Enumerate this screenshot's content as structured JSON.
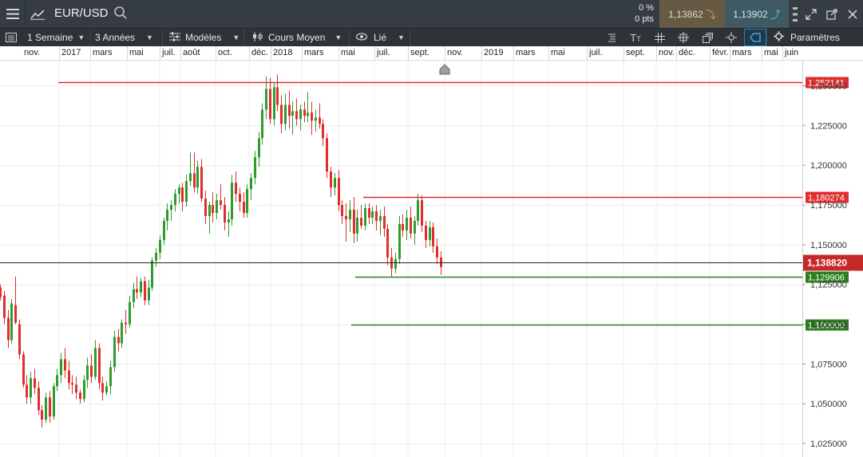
{
  "header": {
    "symbol": "EUR/USD",
    "change_percent": "0 %",
    "change_points": "0 pts",
    "sell_price": "1,13862",
    "buy_price": "1,13902",
    "icons": [
      "menu-icon",
      "chart-line-icon",
      "search-icon",
      "more-dots-icon",
      "expand-icon",
      "popout-icon",
      "close-icon"
    ]
  },
  "toolbar": {
    "interval": "1 Semaine",
    "range": "3 Années",
    "templates": "Modèles",
    "price_type": "Cours Moyen",
    "link": "Lié",
    "settings": "Paramètres",
    "icons": [
      "list-icon",
      "text-tool-icon",
      "grid-icon",
      "crosshair-icon",
      "layers-icon",
      "target-icon",
      "label-icon",
      "gear-icon"
    ]
  },
  "colors": {
    "up": "#2e9b2e",
    "down": "#e02d2d",
    "resistance": "#e02d2d",
    "support": "#2e7d1e",
    "current": "#222222",
    "current_tag": "#c62828"
  },
  "chart_data": {
    "type": "candlestick",
    "x_axis_labels": [
      "nov.",
      "2017",
      "mars",
      "mai",
      "juil.",
      "août",
      "oct.",
      "déc.",
      "2018",
      "mars",
      "mai",
      "juil.",
      "sept.",
      "nov.",
      "2019",
      "mars",
      "mai",
      "juil.",
      "sept.",
      "nov.",
      "déc.",
      "févr.",
      "mars",
      "mai",
      "juin"
    ],
    "y_ticks": [
      "1,250000",
      "1,225000",
      "1,200000",
      "1,175000",
      "1,150000",
      "1,125000",
      "1,100000",
      "1,075000",
      "1,050000",
      "1,025000"
    ],
    "ylim": [
      1.0165,
      1.2658
    ],
    "horizontal_lines": [
      {
        "label": "1,252141",
        "value": 1.252141,
        "kind": "resistance"
      },
      {
        "label": "1,180274",
        "value": 1.180274,
        "kind": "resistance"
      },
      {
        "label": "1,129906",
        "value": 1.129906,
        "kind": "support"
      },
      {
        "label": "1,100000",
        "value": 1.1,
        "kind": "support"
      }
    ],
    "current_price": {
      "label": "1,138820",
      "value": 1.13882
    },
    "candles": [
      {
        "o": 1.123,
        "h": 1.125,
        "l": 1.115,
        "c": 1.117
      },
      {
        "o": 1.118,
        "h": 1.121,
        "l": 1.1,
        "c": 1.104
      },
      {
        "o": 1.104,
        "h": 1.109,
        "l": 1.085,
        "c": 1.09
      },
      {
        "o": 1.09,
        "h": 1.116,
        "l": 1.088,
        "c": 1.113
      },
      {
        "o": 1.112,
        "h": 1.13,
        "l": 1.1,
        "c": 1.101
      },
      {
        "o": 1.1,
        "h": 1.103,
        "l": 1.078,
        "c": 1.081
      },
      {
        "o": 1.081,
        "h": 1.083,
        "l": 1.06,
        "c": 1.062
      },
      {
        "o": 1.062,
        "h": 1.068,
        "l": 1.05,
        "c": 1.054
      },
      {
        "o": 1.054,
        "h": 1.07,
        "l": 1.05,
        "c": 1.066
      },
      {
        "o": 1.066,
        "h": 1.072,
        "l": 1.056,
        "c": 1.06
      },
      {
        "o": 1.06,
        "h": 1.064,
        "l": 1.043,
        "c": 1.046
      },
      {
        "o": 1.046,
        "h": 1.049,
        "l": 1.035,
        "c": 1.04
      },
      {
        "o": 1.04,
        "h": 1.057,
        "l": 1.038,
        "c": 1.054
      },
      {
        "o": 1.054,
        "h": 1.058,
        "l": 1.038,
        "c": 1.042
      },
      {
        "o": 1.042,
        "h": 1.063,
        "l": 1.04,
        "c": 1.061
      },
      {
        "o": 1.061,
        "h": 1.072,
        "l": 1.058,
        "c": 1.068
      },
      {
        "o": 1.068,
        "h": 1.082,
        "l": 1.063,
        "c": 1.078
      },
      {
        "o": 1.078,
        "h": 1.085,
        "l": 1.066,
        "c": 1.071
      },
      {
        "o": 1.071,
        "h": 1.077,
        "l": 1.059,
        "c": 1.063
      },
      {
        "o": 1.063,
        "h": 1.068,
        "l": 1.056,
        "c": 1.062
      },
      {
        "o": 1.062,
        "h": 1.067,
        "l": 1.053,
        "c": 1.057
      },
      {
        "o": 1.057,
        "h": 1.059,
        "l": 1.05,
        "c": 1.053
      },
      {
        "o": 1.053,
        "h": 1.068,
        "l": 1.051,
        "c": 1.065
      },
      {
        "o": 1.065,
        "h": 1.079,
        "l": 1.06,
        "c": 1.074
      },
      {
        "o": 1.074,
        "h": 1.081,
        "l": 1.063,
        "c": 1.067
      },
      {
        "o": 1.067,
        "h": 1.09,
        "l": 1.065,
        "c": 1.085
      },
      {
        "o": 1.085,
        "h": 1.088,
        "l": 1.059,
        "c": 1.063
      },
      {
        "o": 1.063,
        "h": 1.067,
        "l": 1.052,
        "c": 1.057
      },
      {
        "o": 1.057,
        "h": 1.064,
        "l": 1.055,
        "c": 1.061
      },
      {
        "o": 1.061,
        "h": 1.077,
        "l": 1.056,
        "c": 1.073
      },
      {
        "o": 1.073,
        "h": 1.096,
        "l": 1.07,
        "c": 1.092
      },
      {
        "o": 1.092,
        "h": 1.097,
        "l": 1.083,
        "c": 1.088
      },
      {
        "o": 1.088,
        "h": 1.103,
        "l": 1.085,
        "c": 1.101
      },
      {
        "o": 1.101,
        "h": 1.109,
        "l": 1.094,
        "c": 1.1
      },
      {
        "o": 1.1,
        "h": 1.118,
        "l": 1.098,
        "c": 1.114
      },
      {
        "o": 1.114,
        "h": 1.126,
        "l": 1.11,
        "c": 1.122
      },
      {
        "o": 1.122,
        "h": 1.13,
        "l": 1.116,
        "c": 1.12
      },
      {
        "o": 1.12,
        "h": 1.129,
        "l": 1.117,
        "c": 1.127
      },
      {
        "o": 1.127,
        "h": 1.13,
        "l": 1.112,
        "c": 1.115
      },
      {
        "o": 1.115,
        "h": 1.128,
        "l": 1.112,
        "c": 1.123
      },
      {
        "o": 1.123,
        "h": 1.142,
        "l": 1.121,
        "c": 1.14
      },
      {
        "o": 1.14,
        "h": 1.148,
        "l": 1.136,
        "c": 1.145
      },
      {
        "o": 1.145,
        "h": 1.156,
        "l": 1.141,
        "c": 1.153
      },
      {
        "o": 1.153,
        "h": 1.167,
        "l": 1.15,
        "c": 1.165
      },
      {
        "o": 1.165,
        "h": 1.176,
        "l": 1.159,
        "c": 1.172
      },
      {
        "o": 1.172,
        "h": 1.178,
        "l": 1.165,
        "c": 1.175
      },
      {
        "o": 1.175,
        "h": 1.185,
        "l": 1.171,
        "c": 1.182
      },
      {
        "o": 1.182,
        "h": 1.188,
        "l": 1.176,
        "c": 1.186
      },
      {
        "o": 1.186,
        "h": 1.189,
        "l": 1.171,
        "c": 1.177
      },
      {
        "o": 1.177,
        "h": 1.194,
        "l": 1.174,
        "c": 1.19
      },
      {
        "o": 1.19,
        "h": 1.208,
        "l": 1.187,
        "c": 1.195
      },
      {
        "o": 1.195,
        "h": 1.208,
        "l": 1.183,
        "c": 1.186
      },
      {
        "o": 1.186,
        "h": 1.203,
        "l": 1.182,
        "c": 1.199
      },
      {
        "o": 1.199,
        "h": 1.204,
        "l": 1.177,
        "c": 1.179
      },
      {
        "o": 1.179,
        "h": 1.184,
        "l": 1.163,
        "c": 1.168
      },
      {
        "o": 1.168,
        "h": 1.177,
        "l": 1.157,
        "c": 1.175
      },
      {
        "o": 1.175,
        "h": 1.183,
        "l": 1.164,
        "c": 1.17
      },
      {
        "o": 1.17,
        "h": 1.182,
        "l": 1.166,
        "c": 1.178
      },
      {
        "o": 1.178,
        "h": 1.188,
        "l": 1.172,
        "c": 1.175
      },
      {
        "o": 1.175,
        "h": 1.18,
        "l": 1.159,
        "c": 1.164
      },
      {
        "o": 1.164,
        "h": 1.171,
        "l": 1.155,
        "c": 1.166
      },
      {
        "o": 1.166,
        "h": 1.194,
        "l": 1.162,
        "c": 1.189
      },
      {
        "o": 1.189,
        "h": 1.196,
        "l": 1.177,
        "c": 1.182
      },
      {
        "o": 1.182,
        "h": 1.186,
        "l": 1.171,
        "c": 1.177
      },
      {
        "o": 1.177,
        "h": 1.183,
        "l": 1.167,
        "c": 1.17
      },
      {
        "o": 1.17,
        "h": 1.188,
        "l": 1.167,
        "c": 1.185
      },
      {
        "o": 1.185,
        "h": 1.195,
        "l": 1.178,
        "c": 1.192
      },
      {
        "o": 1.192,
        "h": 1.209,
        "l": 1.188,
        "c": 1.205
      },
      {
        "o": 1.205,
        "h": 1.221,
        "l": 1.199,
        "c": 1.217
      },
      {
        "o": 1.217,
        "h": 1.239,
        "l": 1.213,
        "c": 1.235
      },
      {
        "o": 1.235,
        "h": 1.256,
        "l": 1.229,
        "c": 1.248
      },
      {
        "o": 1.248,
        "h": 1.255,
        "l": 1.226,
        "c": 1.229
      },
      {
        "o": 1.229,
        "h": 1.252,
        "l": 1.225,
        "c": 1.249
      },
      {
        "o": 1.249,
        "h": 1.257,
        "l": 1.234,
        "c": 1.238
      },
      {
        "o": 1.238,
        "h": 1.244,
        "l": 1.22,
        "c": 1.226
      },
      {
        "o": 1.226,
        "h": 1.245,
        "l": 1.222,
        "c": 1.238
      },
      {
        "o": 1.238,
        "h": 1.247,
        "l": 1.223,
        "c": 1.231
      },
      {
        "o": 1.231,
        "h": 1.24,
        "l": 1.219,
        "c": 1.234
      },
      {
        "o": 1.234,
        "h": 1.242,
        "l": 1.225,
        "c": 1.229
      },
      {
        "o": 1.229,
        "h": 1.238,
        "l": 1.222,
        "c": 1.235
      },
      {
        "o": 1.235,
        "h": 1.24,
        "l": 1.227,
        "c": 1.231
      },
      {
        "o": 1.231,
        "h": 1.246,
        "l": 1.227,
        "c": 1.233
      },
      {
        "o": 1.233,
        "h": 1.24,
        "l": 1.219,
        "c": 1.228
      },
      {
        "o": 1.228,
        "h": 1.235,
        "l": 1.221,
        "c": 1.23
      },
      {
        "o": 1.23,
        "h": 1.239,
        "l": 1.223,
        "c": 1.226
      },
      {
        "o": 1.226,
        "h": 1.229,
        "l": 1.212,
        "c": 1.217
      },
      {
        "o": 1.217,
        "h": 1.22,
        "l": 1.192,
        "c": 1.196
      },
      {
        "o": 1.196,
        "h": 1.199,
        "l": 1.18,
        "c": 1.186
      },
      {
        "o": 1.186,
        "h": 1.195,
        "l": 1.181,
        "c": 1.192
      },
      {
        "o": 1.192,
        "h": 1.197,
        "l": 1.171,
        "c": 1.175
      },
      {
        "o": 1.175,
        "h": 1.178,
        "l": 1.163,
        "c": 1.168
      },
      {
        "o": 1.168,
        "h": 1.176,
        "l": 1.152,
        "c": 1.166
      },
      {
        "o": 1.166,
        "h": 1.178,
        "l": 1.158,
        "c": 1.172
      },
      {
        "o": 1.172,
        "h": 1.18,
        "l": 1.151,
        "c": 1.157
      },
      {
        "o": 1.157,
        "h": 1.172,
        "l": 1.152,
        "c": 1.167
      },
      {
        "o": 1.167,
        "h": 1.175,
        "l": 1.16,
        "c": 1.162
      },
      {
        "o": 1.162,
        "h": 1.176,
        "l": 1.159,
        "c": 1.173
      },
      {
        "o": 1.173,
        "h": 1.176,
        "l": 1.163,
        "c": 1.167
      },
      {
        "o": 1.167,
        "h": 1.174,
        "l": 1.163,
        "c": 1.171
      },
      {
        "o": 1.171,
        "h": 1.175,
        "l": 1.159,
        "c": 1.165
      },
      {
        "o": 1.165,
        "h": 1.172,
        "l": 1.156,
        "c": 1.168
      },
      {
        "o": 1.168,
        "h": 1.174,
        "l": 1.155,
        "c": 1.16
      },
      {
        "o": 1.16,
        "h": 1.163,
        "l": 1.137,
        "c": 1.142
      },
      {
        "o": 1.142,
        "h": 1.148,
        "l": 1.13,
        "c": 1.135
      },
      {
        "o": 1.135,
        "h": 1.145,
        "l": 1.132,
        "c": 1.141
      },
      {
        "o": 1.141,
        "h": 1.168,
        "l": 1.138,
        "c": 1.163
      },
      {
        "o": 1.163,
        "h": 1.169,
        "l": 1.155,
        "c": 1.159
      },
      {
        "o": 1.159,
        "h": 1.172,
        "l": 1.153,
        "c": 1.167
      },
      {
        "o": 1.167,
        "h": 1.174,
        "l": 1.154,
        "c": 1.157
      },
      {
        "o": 1.157,
        "h": 1.168,
        "l": 1.15,
        "c": 1.165
      },
      {
        "o": 1.165,
        "h": 1.182,
        "l": 1.162,
        "c": 1.178
      },
      {
        "o": 1.178,
        "h": 1.181,
        "l": 1.158,
        "c": 1.162
      },
      {
        "o": 1.162,
        "h": 1.165,
        "l": 1.148,
        "c": 1.153
      },
      {
        "o": 1.153,
        "h": 1.165,
        "l": 1.149,
        "c": 1.161
      },
      {
        "o": 1.161,
        "h": 1.164,
        "l": 1.145,
        "c": 1.149
      },
      {
        "o": 1.149,
        "h": 1.154,
        "l": 1.138,
        "c": 1.142
      },
      {
        "o": 1.142,
        "h": 1.146,
        "l": 1.131,
        "c": 1.136
      }
    ]
  }
}
